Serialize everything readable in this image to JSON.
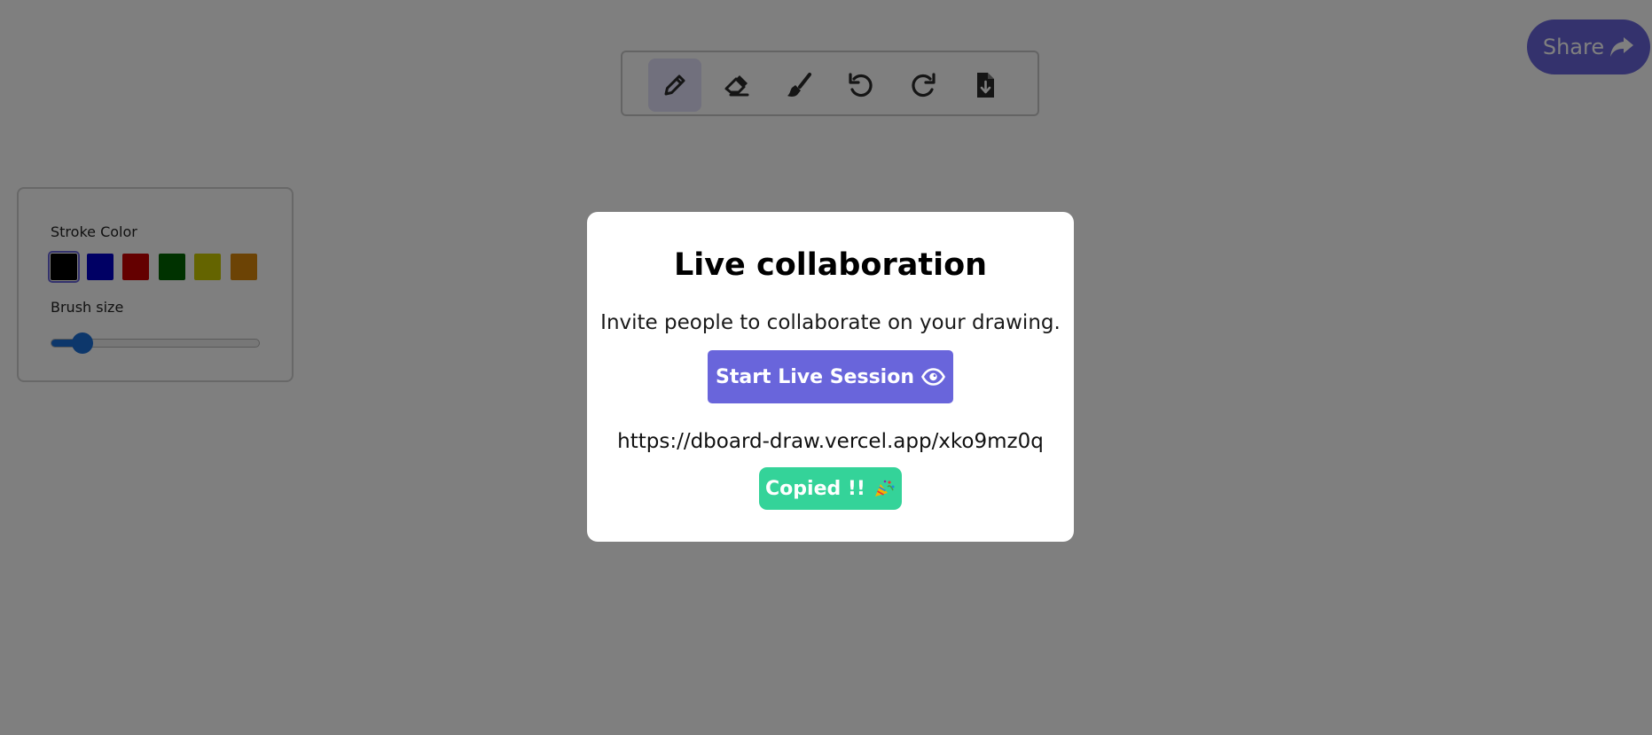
{
  "toolbar": {
    "tools": [
      {
        "name": "pencil-icon",
        "active": true
      },
      {
        "name": "eraser-icon",
        "active": false
      },
      {
        "name": "brush-icon",
        "active": false
      },
      {
        "name": "undo-icon",
        "active": false
      },
      {
        "name": "redo-icon",
        "active": false
      },
      {
        "name": "download-file-icon",
        "active": false
      }
    ],
    "active_tool_color": "#e2e0fb",
    "icon_color": "#2b2b2b"
  },
  "share": {
    "label": "Share",
    "icon": "share-arrow-icon",
    "color": "#6965db"
  },
  "side_panel": {
    "stroke_color_label": "Stroke Color",
    "swatches": [
      "#000000",
      "#0000c8",
      "#c80000",
      "#006400",
      "#c8c800",
      "#d8860b"
    ],
    "selected_swatch": 0,
    "brush_size_label": "Brush size",
    "brush_size_fraction": 0.15
  },
  "modal": {
    "title": "Live collaboration",
    "description": "Invite people to collaborate on your drawing.",
    "start_button_label": "Start Live Session",
    "start_button_icon": "eye-icon",
    "link": "https://dboard-draw.vercel.app/xko9mz0q",
    "copied_label": "Copied !!",
    "copied_icon": "party-emoji-icon",
    "primary_color": "#6965db",
    "success_color": "#34d399"
  }
}
